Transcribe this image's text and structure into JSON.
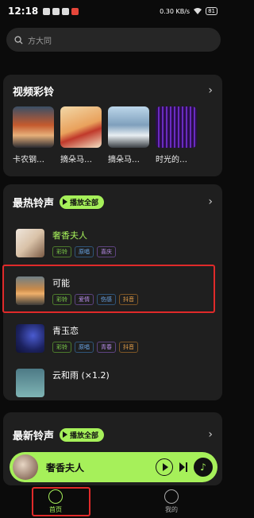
{
  "status": {
    "time": "12:18",
    "net_speed": "0.30 KB/s",
    "battery": "81"
  },
  "search": {
    "placeholder": "方大同"
  },
  "video_section": {
    "title": "视频彩铃",
    "items": [
      {
        "label": "卡农钢…"
      },
      {
        "label": "摘朵马…"
      },
      {
        "label": "摘朵马…"
      },
      {
        "label": "时光的…"
      }
    ]
  },
  "hot_section": {
    "title": "最热铃声",
    "play_all": "播放全部",
    "songs": [
      {
        "name": "奢香夫人",
        "tags": [
          "彩铃",
          "原唱",
          "喜庆"
        ]
      },
      {
        "name": "可能",
        "tags": [
          "彩铃",
          "爱情",
          "伤感",
          "抖音"
        ]
      },
      {
        "name": "青玉恋",
        "tags": [
          "彩铃",
          "原唱",
          "青春",
          "抖音"
        ]
      },
      {
        "name": "云和雨 (×1.2)",
        "tags": []
      }
    ]
  },
  "new_section": {
    "title": "最新铃声",
    "play_all": "播放全部"
  },
  "player": {
    "song": "奢香夫人"
  },
  "tabs": [
    {
      "label": "首页"
    },
    {
      "label": "我的"
    }
  ]
}
